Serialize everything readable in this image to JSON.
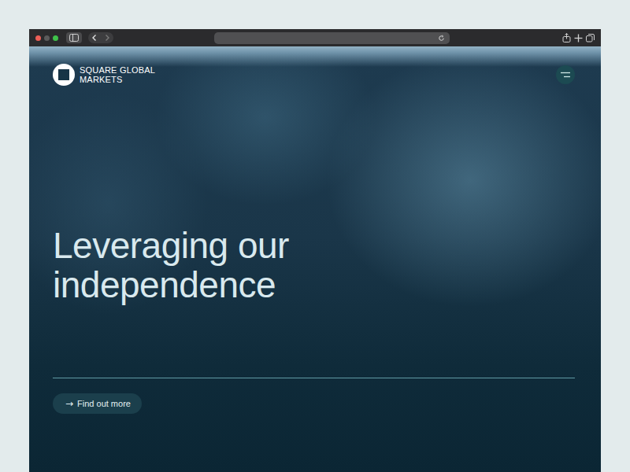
{
  "browser": {
    "address": ""
  },
  "site": {
    "logo": {
      "text": "SQUARE GLOBAL MARKETS"
    },
    "headline": "Leveraging our independence",
    "cta": {
      "icon": "→",
      "label": "Find out more"
    }
  }
}
